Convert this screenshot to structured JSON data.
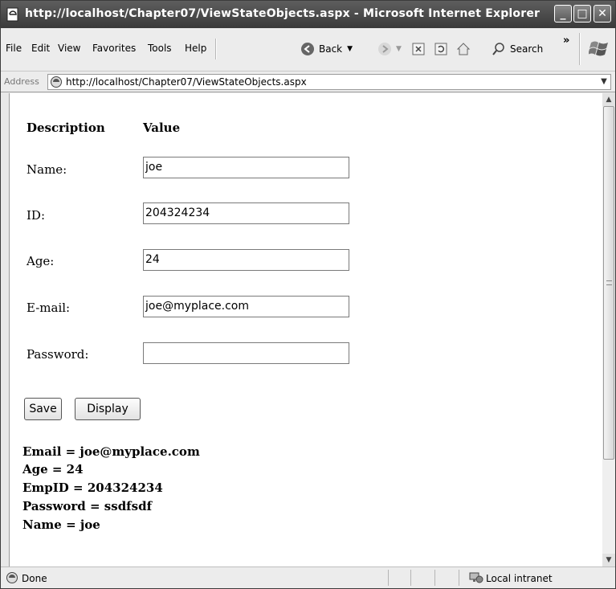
{
  "window": {
    "title": "http://localhost/Chapter07/ViewStateObjects.aspx - Microsoft Internet Explorer",
    "minimize_label": "_",
    "maximize_label": "□",
    "close_label": "✕"
  },
  "menu": {
    "items": [
      "File",
      "Edit",
      "View",
      "Favorites",
      "Tools",
      "Help"
    ]
  },
  "toolbar": {
    "back_label": "Back",
    "search_label": "Search",
    "overflow_label": "»"
  },
  "address": {
    "label": "Address",
    "url": "http://localhost/Chapter07/ViewStateObjects.aspx"
  },
  "form": {
    "header_description": "Description",
    "header_value": "Value",
    "fields": [
      {
        "label": "Name:",
        "value": "joe"
      },
      {
        "label": "ID:",
        "value": "204324234"
      },
      {
        "label": "Age:",
        "value": "24"
      },
      {
        "label": "E-mail:",
        "value": "joe@myplace.com"
      },
      {
        "label": "Password:",
        "value": ""
      }
    ],
    "save_label": "Save",
    "display_label": "Display"
  },
  "output": {
    "lines": [
      "Email = joe@myplace.com",
      "Age = 24",
      "EmpID = 204324234",
      "Password = ssdfsdf",
      "Name = joe"
    ]
  },
  "status": {
    "text": "Done",
    "zone": "Local intranet"
  }
}
